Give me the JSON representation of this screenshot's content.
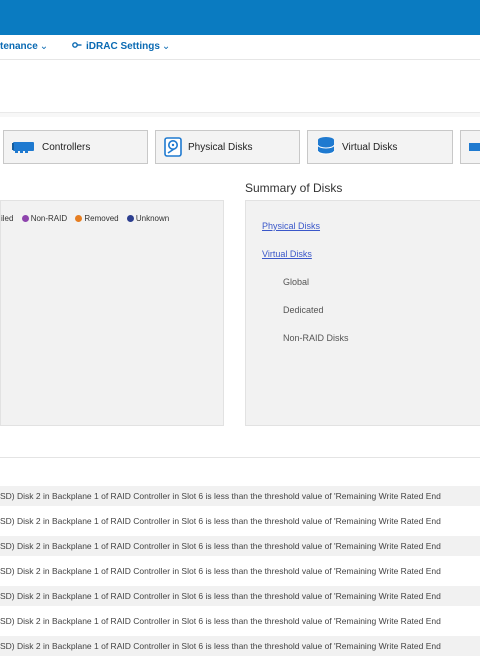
{
  "nav": {
    "maintenance_label": "tenance",
    "idrac_settings_label": "iDRAC Settings"
  },
  "tabs": [
    {
      "label": "Controllers"
    },
    {
      "label": "Physical Disks"
    },
    {
      "label": "Virtual Disks"
    }
  ],
  "summary": {
    "title": "Summary of Disks",
    "links": {
      "physical": "Physical Disks",
      "virtual": "Virtual Disks"
    },
    "subitems": [
      "Global",
      "Dedicated",
      "Non-RAID Disks"
    ]
  },
  "legend": {
    "items": [
      {
        "label": "iled",
        "color": ""
      },
      {
        "label": "Non-RAID",
        "color": "#8e44ad"
      },
      {
        "label": "Removed",
        "color": "#e67e22"
      },
      {
        "label": "Unknown",
        "color": "#2c3e8f"
      }
    ]
  },
  "log": {
    "message": "SD) Disk 2 in Backplane 1 of RAID Controller in Slot 6 is less than the threshold value of 'Remaining Write Rated End",
    "rows": 7
  },
  "colors": {
    "topbar": "#0a7bc1",
    "link": "#3a57c9"
  }
}
